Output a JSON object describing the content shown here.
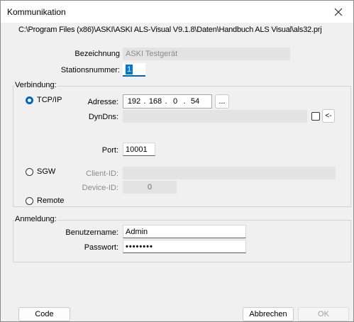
{
  "window": {
    "title": "Kommunikation"
  },
  "path": "C:\\Program Files (x86)\\ASKI\\ASKI ALS-Visual V9.1.8\\Daten\\Handbuch ALS Visual\\als32.prj",
  "device": {
    "name_label": "Bezeichnung",
    "name_value": "ASKI Testgerät",
    "station_label": "Stationsnummer:",
    "station_value": "1"
  },
  "connection": {
    "group_label": "Verbindung:",
    "tcpip": {
      "radio_label": "TCP/IP",
      "selected": true,
      "address_label": "Adresse:",
      "ip": [
        "192",
        "168",
        "0",
        "54"
      ],
      "browse_label": "...",
      "dyndns_label": "DynDns:",
      "dyndns_value": "",
      "dyndns_button_label": "<-",
      "port_label": "Port:",
      "port_value": "10001"
    },
    "sgw": {
      "radio_label": "SGW",
      "selected": false,
      "client_id_label": "Client-ID:",
      "client_id_value": "",
      "device_id_label": "Device-ID:",
      "device_id_value": "0"
    },
    "remote": {
      "radio_label": "Remote",
      "selected": false
    }
  },
  "login": {
    "group_label": "Anmeldung:",
    "username_label": "Benutzername:",
    "username_value": "Admin",
    "password_label": "Passwort:",
    "password_value": "••••••••"
  },
  "buttons": {
    "code": "Code",
    "cancel": "Abbrechen",
    "ok": "OK"
  },
  "colors": {
    "accent": "#0067c0",
    "title_bg": "#ffffff",
    "dialog_bg": "#f0f0f0"
  }
}
